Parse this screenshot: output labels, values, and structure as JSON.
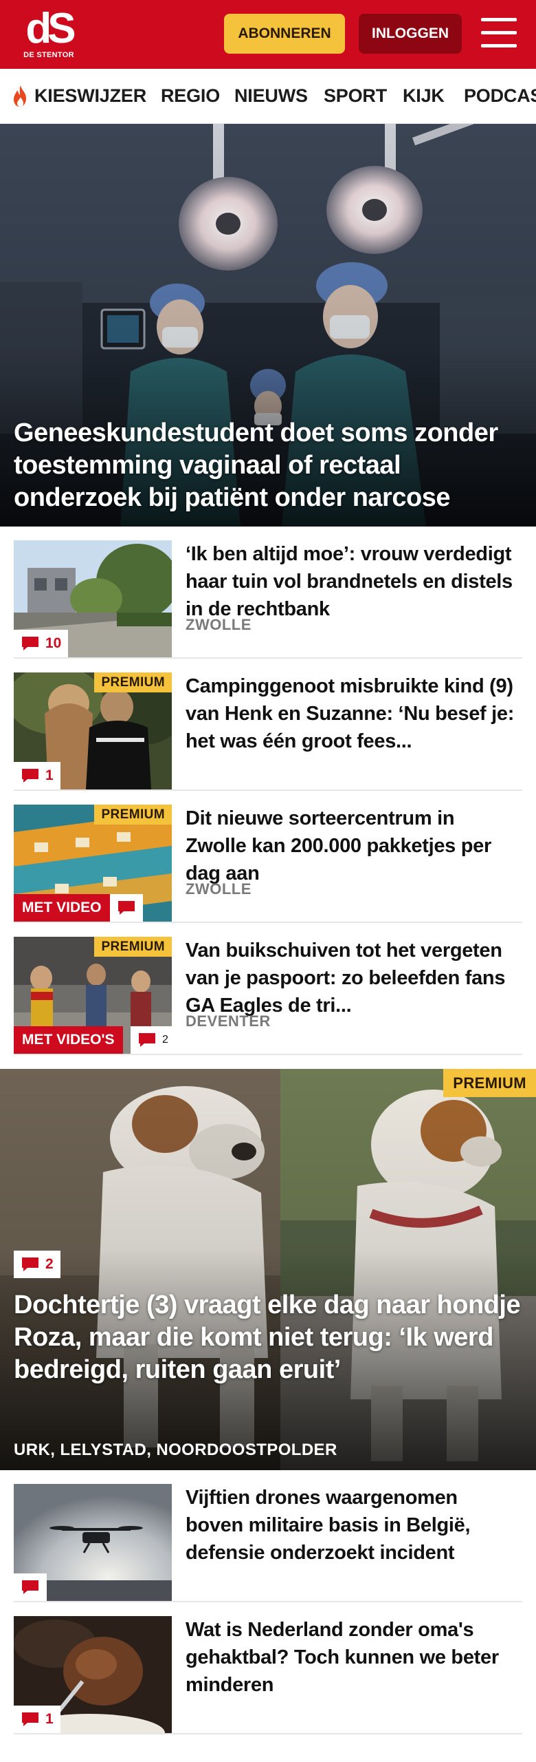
{
  "header": {
    "logo_mark": "dS",
    "logo_sub": "DE STENTOR",
    "subscribe_label": "ABONNEREN",
    "login_label": "INLOGGEN",
    "brand_color": "#cd0a1e",
    "accent_color": "#f5c33b",
    "menu_icon": "hamburger-menu-icon"
  },
  "nav": {
    "items": [
      {
        "label": "KIESWIJZER",
        "icon": "flame-icon"
      },
      {
        "label": "REGIO"
      },
      {
        "label": "NIEUWS"
      },
      {
        "label": "SPORT"
      },
      {
        "label": "KIJK"
      },
      {
        "label": "PODCAS"
      }
    ]
  },
  "hero": {
    "title": "Geneeskundestudent doet soms zonder toestemming vaginaal of rectaal onderzoek bij patiënt onder narcose"
  },
  "articles": [
    {
      "title": "‘Ik ben altijd moe’: vrouw verdedigt haar tuin vol brandne­tels en distels in de rechtbank",
      "location": "ZWOLLE",
      "comments": "10",
      "premium": "",
      "video": ""
    },
    {
      "title": "Campinggenoot misbruikte kind (9) van Henk en Suzanne: ‘Nu besef je: het was één groot fees...",
      "location": "",
      "comments": "1",
      "premium": "PREMIUM",
      "video": ""
    },
    {
      "title": "Dit nieuwe sorteercentrum in Zwolle kan 200.000 pakketjes per dag aan",
      "location": "ZWOLLE",
      "comments": "",
      "premium": "PREMIUM",
      "video": "MET VIDEO"
    },
    {
      "title": "Van buikschuiven tot het vergeten van je paspoort: zo beleefden fans GA Eagles de tri...",
      "location": "DEVENTER",
      "comments": "2",
      "premium": "PREMIUM",
      "video": "MET VIDEO'S"
    }
  ],
  "feature": {
    "title": "Dochtertje (3) vraagt elke dag naar hondje Roza, maar die komt niet terug: ‘Ik werd bedreigd, ruiten gaan eruit’",
    "location": "URK, LELYSTAD, NOORDOOSTPOLDER",
    "comments": "2",
    "premium": "PREMIUM"
  },
  "more_articles": [
    {
      "title": "Vijftien drones waargenomen boven militaire basis in België, defensie onderzoekt incident",
      "comments": ""
    },
    {
      "title": "Wat is Nederland zonder oma's gehaktbal? Toch kunnen we beter minderen",
      "comments": "1"
    }
  ]
}
